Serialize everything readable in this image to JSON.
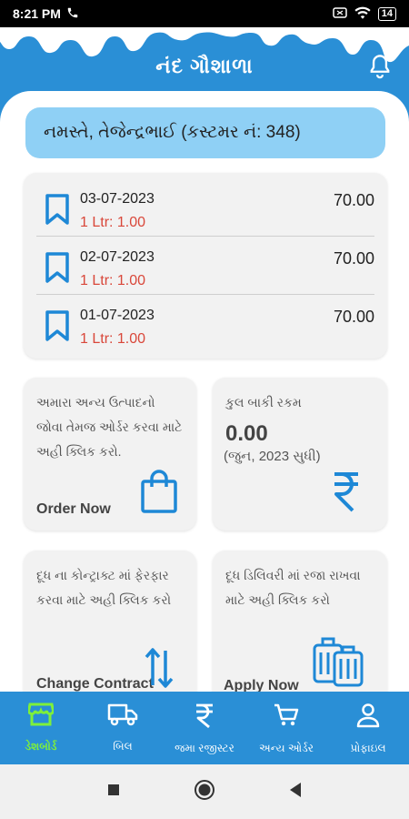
{
  "status_bar": {
    "time": "8:21 PM",
    "battery": "14"
  },
  "header": {
    "title": "નંદ ગૌશાળા"
  },
  "greeting": "નમસ્તે, તેજેન્દ્રભાઈ (કસ્ટમર નં: 348)",
  "orders": [
    {
      "date": "03-07-2023",
      "qty": "1 Ltr: 1.00",
      "amount": "70.00"
    },
    {
      "date": "02-07-2023",
      "qty": "1 Ltr: 1.00",
      "amount": "70.00"
    },
    {
      "date": "01-07-2023",
      "qty": "1 Ltr: 1.00",
      "amount": "70.00"
    }
  ],
  "cards": {
    "order": {
      "desc": "અમારા અન્ય ઉત્પાદનો જોવા તેમજ ઓર્ડર કરવા માટે અહી ક્લિક કરો.",
      "action": "Order Now"
    },
    "balance": {
      "label": "કુલ બાકી રકમ",
      "amount": "0.00",
      "period": "(જુન, 2023 સુધી)"
    },
    "contract": {
      "desc": "દૂધ ના કોન્ટ્રાક્ટ માં ફેરફાર કરવા માટે અહી ક્લિક કરો",
      "action": "Change Contract"
    },
    "leave": {
      "desc": "દૂધ ડિલિવરી માં રજા રાખવા માટે અહી ક્લિક કરો",
      "action": "Apply Now"
    }
  },
  "nav": [
    {
      "label": "ડેશબોર્ડ",
      "icon": "store-icon",
      "active": true
    },
    {
      "label": "બિલ",
      "icon": "truck-icon"
    },
    {
      "label": "જમા રજીસ્ટર",
      "icon": "rupee-icon"
    },
    {
      "label": "અન્ય ઓર્ડર",
      "icon": "cart-icon"
    },
    {
      "label": "પ્રોફાઇલ",
      "icon": "person-icon"
    }
  ],
  "colors": {
    "primary": "#2a8fd6",
    "greeting_bg": "#8fd0f5",
    "active_nav": "#7ef03a",
    "qty_red": "#d9473a"
  }
}
